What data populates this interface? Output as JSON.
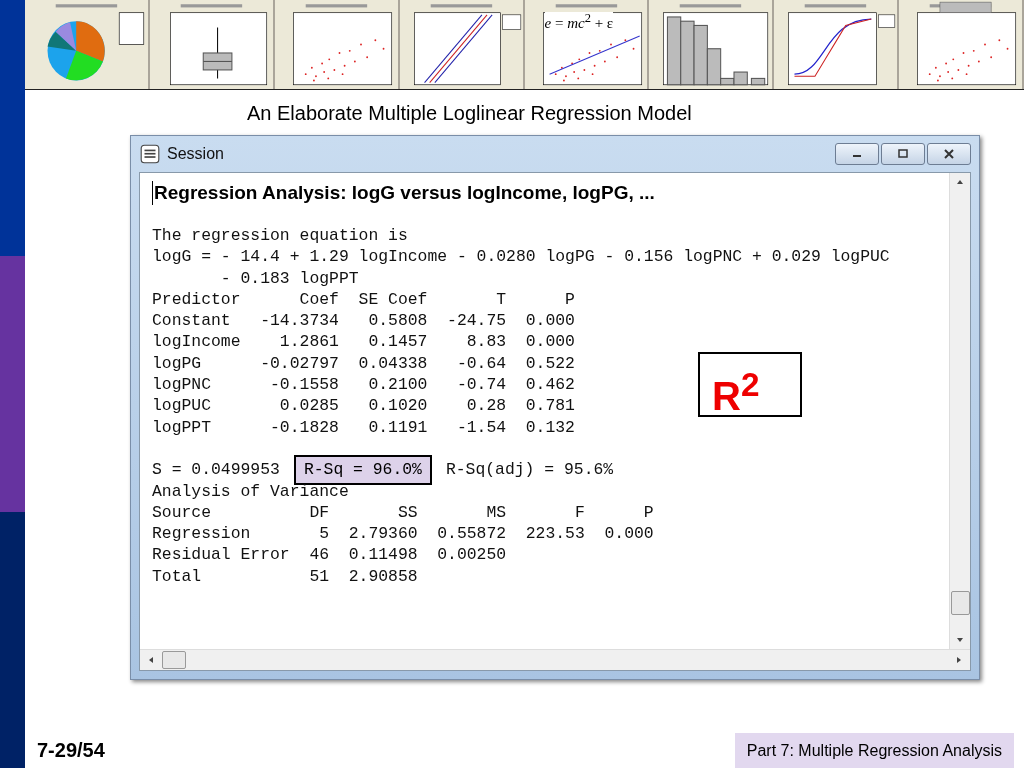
{
  "thumbnails": [
    {
      "kind": "pie"
    },
    {
      "kind": "boxplot"
    },
    {
      "kind": "scatter"
    },
    {
      "kind": "probability"
    },
    {
      "kind": "fitted",
      "equation": "*e* = *mc*$^{2}$ + ε"
    },
    {
      "kind": "histogram"
    },
    {
      "kind": "cdf"
    },
    {
      "kind": "marginal"
    }
  ],
  "slide_title": "An Elaborate Multiple Loglinear Regression Model",
  "window": {
    "title": "Session",
    "heading": "Regression Analysis: logG versus logIncome, logPG, ...",
    "lines_before": [
      "The regression equation is",
      "logG = - 14.4 + 1.29 logIncome - 0.0280 logPG - 0.156 logPNC + 0.029 logPUC",
      "       - 0.183 logPPT",
      "Predictor      Coef  SE Coef       T      P",
      "Constant   -14.3734   0.5808  -24.75  0.000",
      "logIncome    1.2861   0.1457    8.83  0.000",
      "logPG      -0.02797  0.04338   -0.64  0.522",
      "logPNC      -0.1558   0.2100   -0.74  0.462",
      "logPUC       0.0285   0.1020    0.28  0.781",
      "logPPT      -0.1828   0.1191   -1.54  0.132"
    ],
    "stats": {
      "s": "S = 0.0499953",
      "r_sq": "R-Sq = 96.0%",
      "r_sq_adj": "R-Sq(adj) = 95.6%"
    },
    "lines_after": [
      "Analysis of Variance",
      "Source          DF       SS       MS       F      P",
      "Regression       5  2.79360  0.55872  223.53  0.000",
      "Residual Error  46  0.11498  0.00250",
      "Total           51  2.90858"
    ]
  },
  "callout": "R$^{2}$",
  "footer": {
    "page": "7-29/54",
    "section": "Part 7: Multiple Regression Analysis"
  }
}
